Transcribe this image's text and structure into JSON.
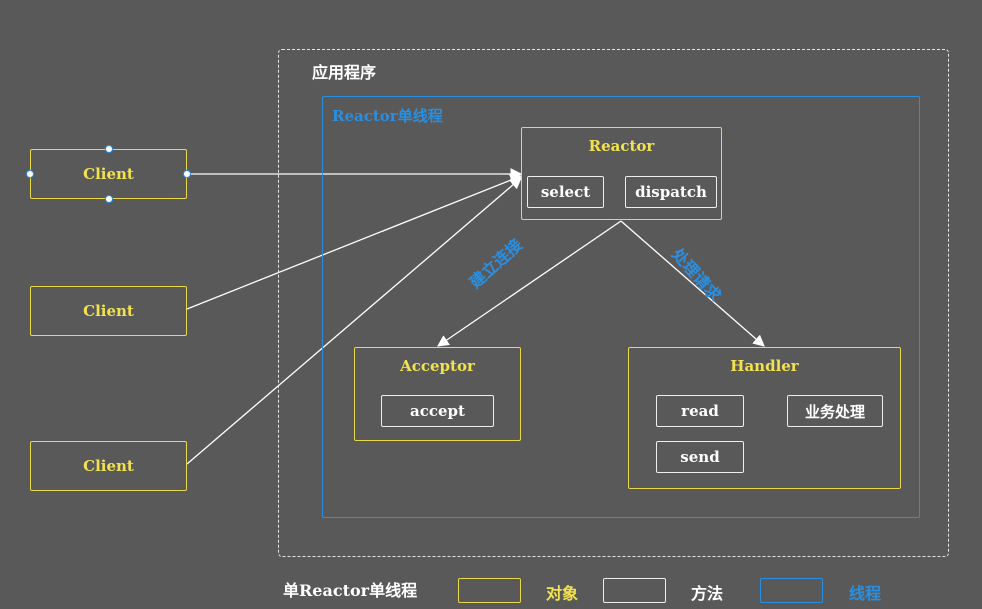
{
  "app": {
    "title": "应用程序"
  },
  "thread": {
    "title": "Reactor单线程"
  },
  "clients": [
    {
      "label": "Client"
    },
    {
      "label": "Client"
    },
    {
      "label": "Client"
    }
  ],
  "reactor": {
    "title": "Reactor",
    "methods": [
      "select",
      "dispatch"
    ]
  },
  "acceptor": {
    "title": "Acceptor",
    "methods": [
      "accept"
    ]
  },
  "handler": {
    "title": "Handler",
    "methods": [
      "read",
      "业务处理",
      "send"
    ]
  },
  "edges": {
    "establish": "建立连接",
    "process": "处理请求"
  },
  "legend": {
    "title": "单Reactor单线程",
    "object_label": "对象",
    "method_label": "方法",
    "thread_label": "线程"
  },
  "colors": {
    "object": "#e8d84a",
    "method": "#ededed",
    "thread": "#2a8fe0",
    "background": "#595959"
  }
}
